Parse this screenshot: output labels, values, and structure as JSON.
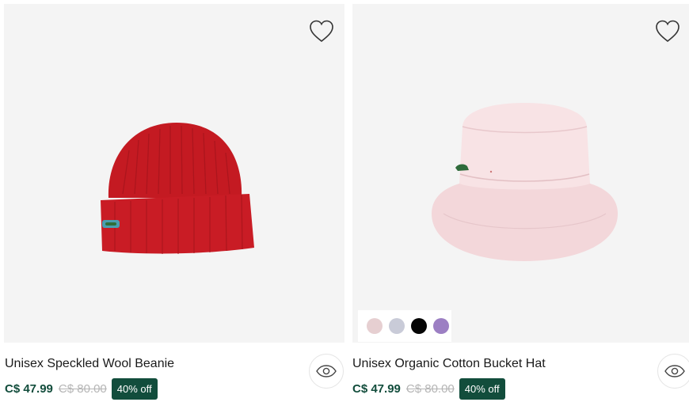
{
  "products": [
    {
      "name": "Unisex Speckled Wool Beanie",
      "price": "C$ 47.99",
      "old_price": "C$ 80.00",
      "discount": "40% off",
      "image_icon": "red-beanie-image",
      "colors": [
        "#c8202a"
      ]
    },
    {
      "name": "Unisex Organic Cotton Bucket Hat",
      "price": "C$ 47.99",
      "old_price": "C$ 80.00",
      "discount": "40% off",
      "image_icon": "pink-bucket-hat-image",
      "swatches": [
        "#e6cfd1",
        "#c9cbd8",
        "#050505",
        "#9c7fc3"
      ]
    }
  ],
  "icons": {
    "wishlist": "heart-icon",
    "quick_view": "eye-icon"
  },
  "colors": {
    "brand_green": "#124d3c",
    "image_bg": "#f4f4f4",
    "strike_gray": "#b5b5b5"
  }
}
